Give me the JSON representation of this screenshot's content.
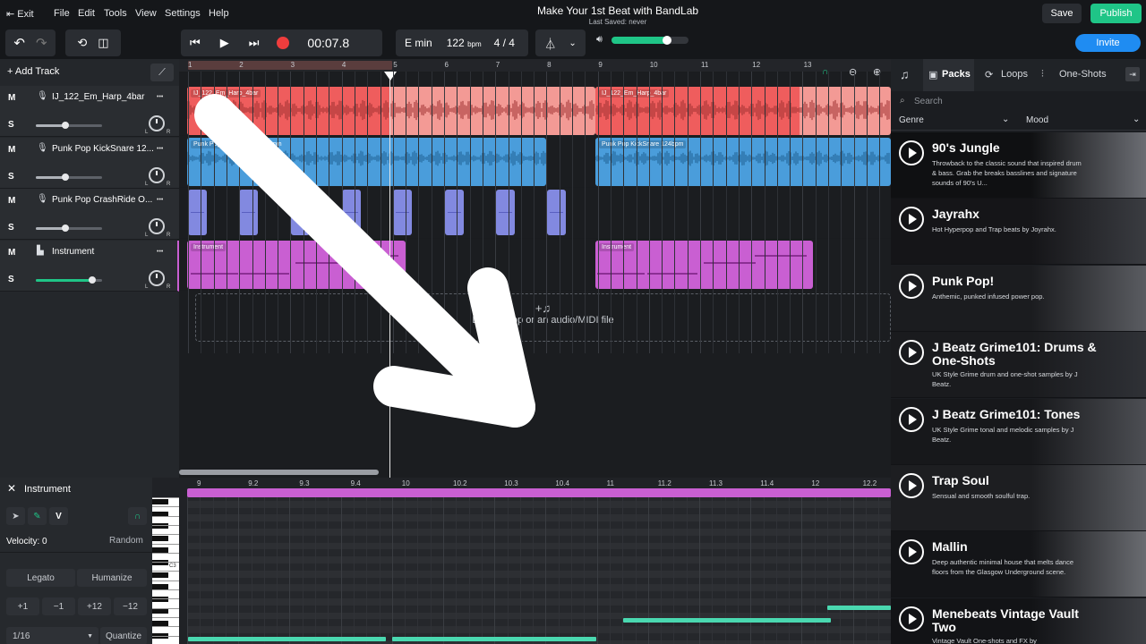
{
  "menubar": {
    "exit": "Exit",
    "items": [
      "File",
      "Edit",
      "Tools",
      "View",
      "Settings",
      "Help"
    ],
    "title": "Make Your 1st Beat with BandLab",
    "saved": "Last Saved: never",
    "save": "Save",
    "publish": "Publish"
  },
  "toolbar": {
    "time": "00:07.8",
    "key": "E min",
    "bpm": "122",
    "bpm_unit": "bpm",
    "signature": "4 / 4",
    "volume": 0.72,
    "invite": "Invite"
  },
  "tracklist": {
    "add_track": "Add Track",
    "tracks": [
      {
        "name": "IJ_122_Em_Harp_4bar",
        "m": "M",
        "s": "S",
        "level": 0.45
      },
      {
        "name": "Punk Pop KickSnare 12...",
        "m": "M",
        "s": "S",
        "level": 0.45
      },
      {
        "name": "Punk Pop CrashRide O...",
        "m": "M",
        "s": "S",
        "level": 0.45
      },
      {
        "name": "Instrument",
        "m": "M",
        "s": "S",
        "level": 0.85
      }
    ],
    "l": "L",
    "r": "R"
  },
  "arrangement": {
    "ruler": [
      "1",
      "2",
      "3",
      "4",
      "5",
      "6",
      "7",
      "8",
      "9",
      "10",
      "11",
      "12",
      "13"
    ],
    "clips": {
      "harp": "IJ_122_Em_Harp_4bar",
      "kick": "Punk Pop KickSnare 124bpm",
      "kick_short": "Punk Pop",
      "kick_tail": "bpm",
      "instrument": "Instrument"
    },
    "drop_text": "Drop a loop or an audio/MIDI file",
    "colors": {
      "harp": "#ef5d5d",
      "harp_light": "#f39a95",
      "kick": "#4a9ddb",
      "crash": "#8289e0",
      "instrument": "#c95fd2",
      "accent": "#1fc587"
    }
  },
  "panel": {
    "tabs": [
      "Packs",
      "Loops",
      "One-Shots"
    ],
    "search": "Search",
    "genre": "Genre",
    "mood": "Mood",
    "packs": [
      {
        "title": "90's Jungle",
        "desc": "Throwback to the classic sound that inspired drum & bass. Grab the breaks basslines and signature sounds of 90's U..."
      },
      {
        "title": "Jayrahx",
        "desc": "Hot Hyperpop and Trap beats by Joyrahx."
      },
      {
        "title": "Punk Pop!",
        "desc": "Anthemic, punked infused power pop."
      },
      {
        "title": "J Beatz Grime101: Drums & One-Shots",
        "desc": "UK Style Grime drum and one-shot samples by J Beatz."
      },
      {
        "title": "J Beatz Grime101: Tones",
        "desc": "UK Style Grime tonal and melodic samples by J Beatz."
      },
      {
        "title": "Trap Soul",
        "desc": "Sensual and smooth soulful trap."
      },
      {
        "title": "Mallin",
        "desc": "Deep authentic minimal house that melts dance floors from the Glasgow Underground scene."
      },
      {
        "title": "Menebeats Vintage Vault Two",
        "desc": "Vintage Vault One-shots and FX by"
      }
    ]
  },
  "editor": {
    "title": "Instrument",
    "velocity": "Velocity: 0",
    "random": "Random",
    "legato": "Legato",
    "humanize": "Humanize",
    "transpose": [
      "+1",
      "−1",
      "+12",
      "−12"
    ],
    "grid": "1/16",
    "quantize": "Quantize",
    "v": "V",
    "c3": "C3",
    "ruler": [
      "9",
      "9.2",
      "9.3",
      "9.4",
      "10",
      "10.2",
      "10.3",
      "10.4",
      "11",
      "11.2",
      "11.3",
      "11.4",
      "12",
      "12.2"
    ]
  }
}
